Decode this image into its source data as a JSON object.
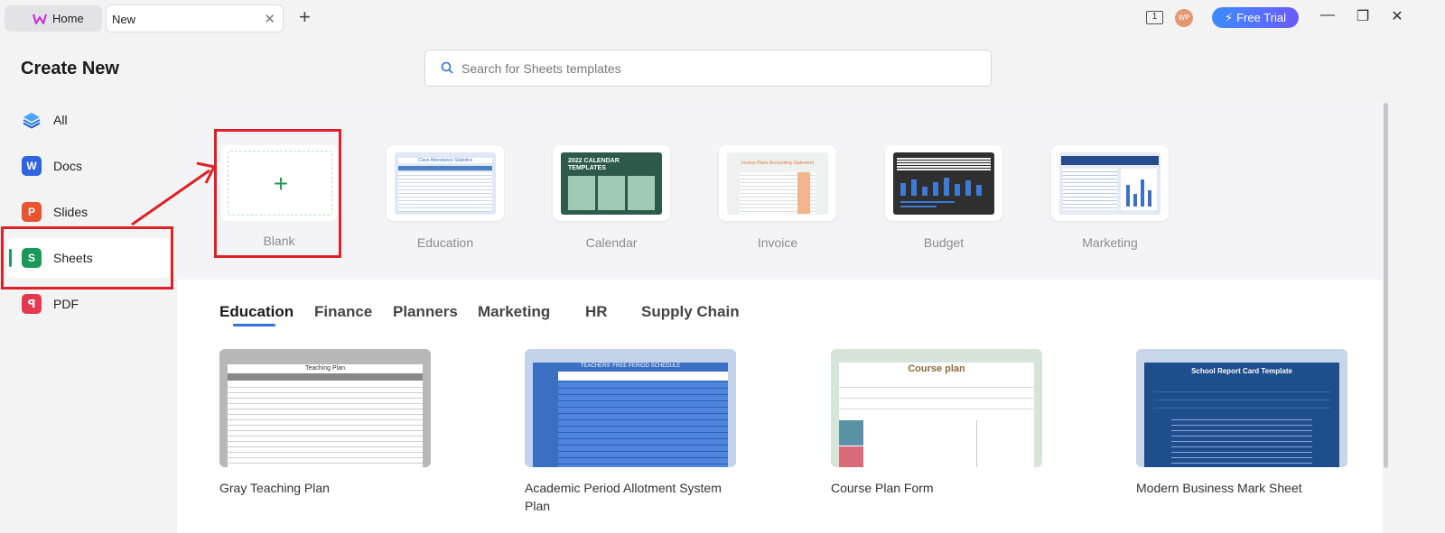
{
  "titlebar": {
    "home_tab": "Home",
    "new_tab": "New",
    "avatar": "WP",
    "free_trial": "Free Trial",
    "badge": "1"
  },
  "sidebar": {
    "title": "Create New",
    "items": [
      {
        "label": "All",
        "icon": "layers-icon",
        "color": "#3a86ff"
      },
      {
        "label": "Docs",
        "icon": "docs-icon",
        "color": "#2f64e0"
      },
      {
        "label": "Slides",
        "icon": "slides-icon",
        "color": "#e8542f"
      },
      {
        "label": "Sheets",
        "icon": "sheets-icon",
        "color": "#1a9a58"
      },
      {
        "label": "PDF",
        "icon": "pdf-icon",
        "color": "#e6384f"
      }
    ]
  },
  "search": {
    "placeholder": "Search for Sheets templates"
  },
  "categories": [
    {
      "label": "Blank"
    },
    {
      "label": "Education",
      "thumb_title": "Class Attendance Statistics"
    },
    {
      "label": "Calendar",
      "thumb_title": "2022 CALENDAR TEMPLATES"
    },
    {
      "label": "Invoice",
      "thumb_title": "Invoice Plane Accounting Statement"
    },
    {
      "label": "Budget"
    },
    {
      "label": "Marketing"
    }
  ],
  "template_tabs": [
    "Education",
    "Finance",
    "Planners",
    "Marketing",
    "HR",
    "Supply Chain"
  ],
  "templates": [
    {
      "name": "Gray Teaching Plan",
      "thumb_title": "Teaching Plan"
    },
    {
      "name": "Academic Period Allotment System Plan",
      "thumb_title": "TEACHERS' FREE PERIOD SCHEDULE"
    },
    {
      "name": "Course Plan Form",
      "thumb_title": "Course plan"
    },
    {
      "name": "Modern Business Mark Sheet",
      "thumb_title": "School Report Card Template"
    }
  ],
  "colors": {
    "accent": "#2f6fe0",
    "sheets_green": "#1a9a58",
    "annotation_red": "#e02025"
  }
}
